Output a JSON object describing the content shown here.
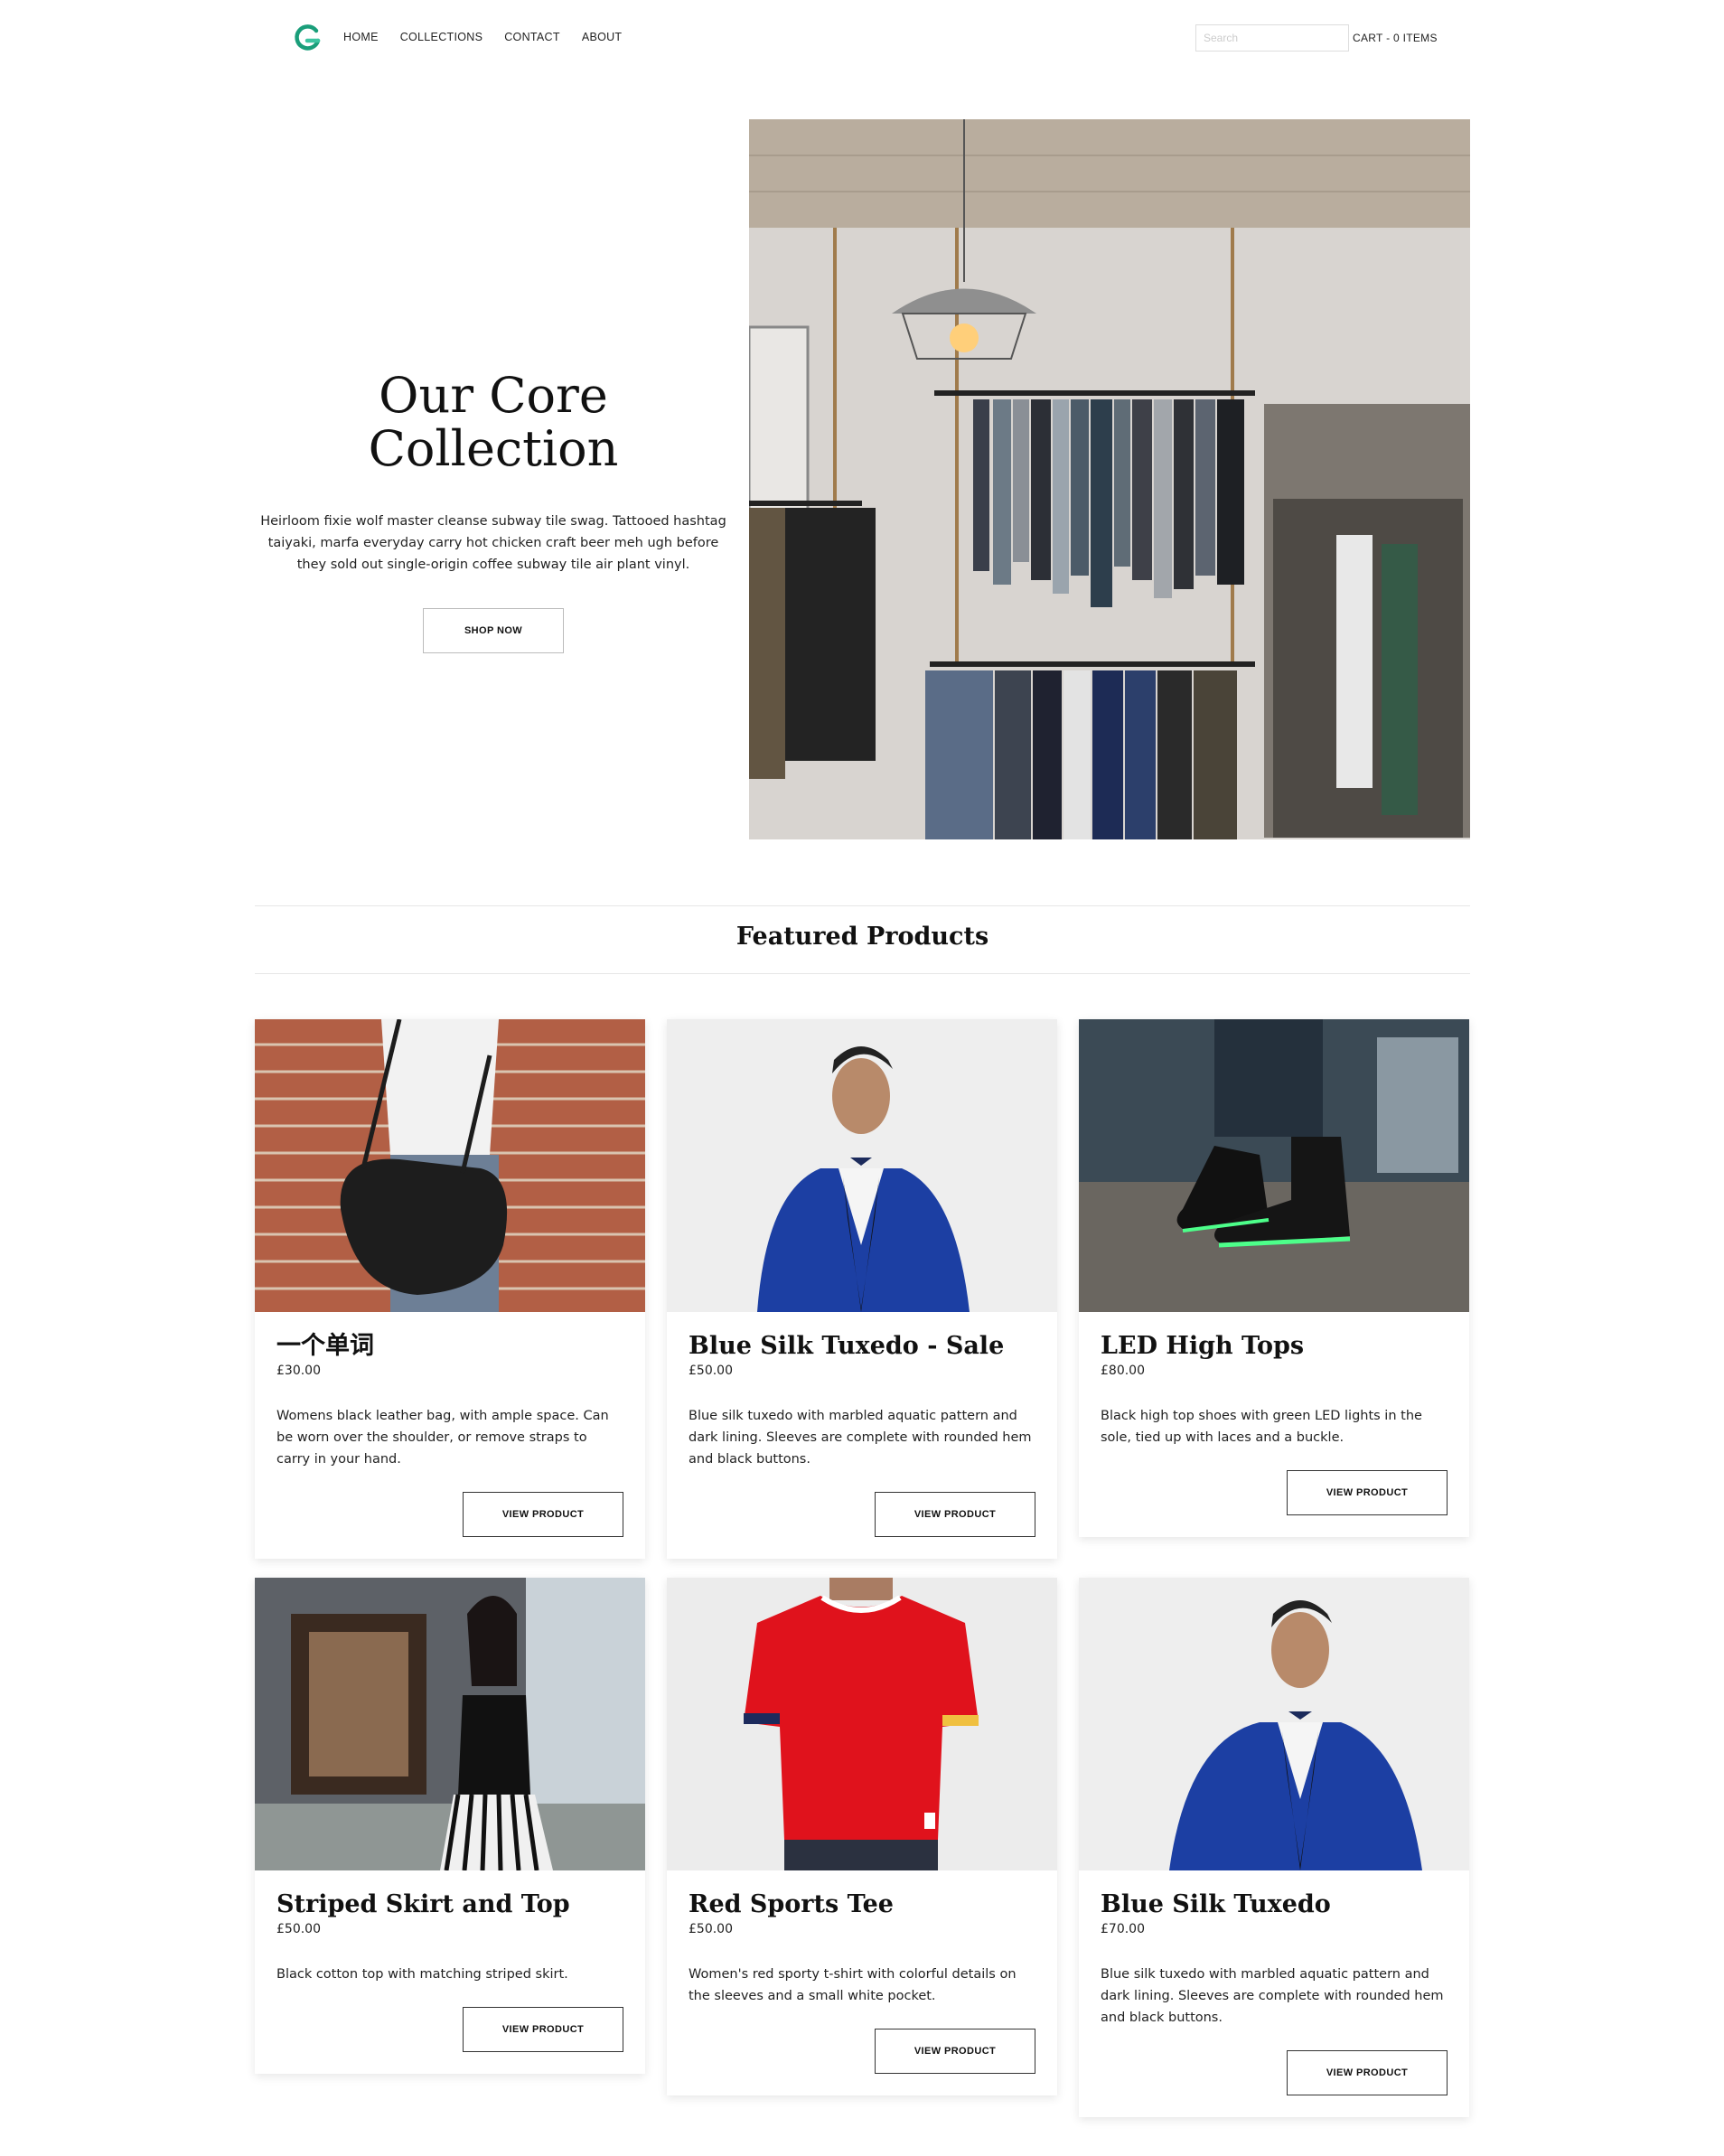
{
  "nav": {
    "links": [
      "HOME",
      "COLLECTIONS",
      "CONTACT",
      "ABOUT"
    ],
    "search_placeholder": "Search",
    "cart": "CART - 0 ITEMS"
  },
  "hero": {
    "title": "Our Core Collection",
    "description": "Heirloom fixie wolf master cleanse subway tile swag. Tattooed hashtag taiyaki, marfa everyday carry hot chicken craft beer meh ugh before they sold out single-origin coffee subway tile air plant vinyl.",
    "button": "SHOP NOW"
  },
  "featured": {
    "title": "Featured Products",
    "products": [
      {
        "name": "一个单词",
        "price": "£30.00",
        "description": "Womens black leather bag, with ample space. Can be worn over the shoulder, or remove straps to carry in your hand.",
        "button": "VIEW PRODUCT"
      },
      {
        "name": "Blue Silk Tuxedo - Sale",
        "price": "£50.00",
        "description": "Blue silk tuxedo with marbled aquatic pattern and dark lining. Sleeves are complete with rounded hem and black buttons.",
        "button": "VIEW PRODUCT"
      },
      {
        "name": "LED High Tops",
        "price": "£80.00",
        "description": "Black high top shoes with green LED lights in the sole, tied up with laces and a buckle.",
        "button": "VIEW PRODUCT"
      },
      {
        "name": "Striped Skirt and Top",
        "price": "£50.00",
        "description": "Black cotton top with matching striped skirt.",
        "button": "VIEW PRODUCT"
      },
      {
        "name": "Red Sports Tee",
        "price": "£50.00",
        "description": "Women's red sporty t-shirt with colorful details on the sleeves and a small white pocket.",
        "button": "VIEW PRODUCT"
      },
      {
        "name": "Blue Silk Tuxedo",
        "price": "£70.00",
        "description": "Blue silk tuxedo with marbled aquatic pattern and dark lining. Sleeves are complete with rounded hem and black buttons.",
        "button": "VIEW PRODUCT"
      }
    ]
  },
  "colors": {
    "logo_green": "#1a9e7a",
    "text": "#222222",
    "rule": "#e6e6e6"
  }
}
